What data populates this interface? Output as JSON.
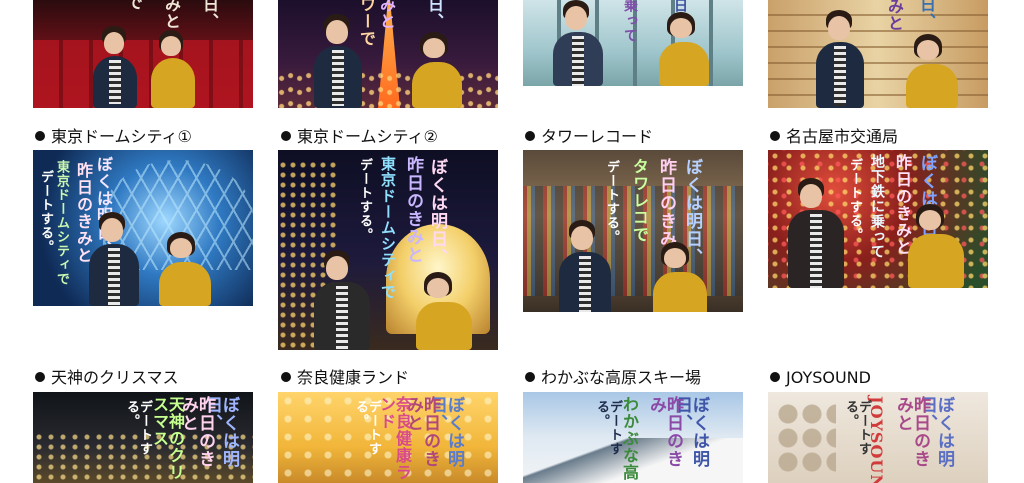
{
  "rows": {
    "row2": [
      {
        "caption": "東京ドームシティ①",
        "title_lines": [
          "ぼくは明日、",
          "昨日のきみと",
          "東京ドームシティで",
          "デートする。"
        ]
      },
      {
        "caption": "東京ドームシティ②",
        "title_lines": [
          "ぼくは明日、",
          "昨日のきみと",
          "東京ドームシティで",
          "デートする。"
        ]
      },
      {
        "caption": "タワーレコード",
        "title_lines": [
          "ぼくは明日、",
          "昨日のきみと",
          "タワレコで",
          "デートする。"
        ]
      },
      {
        "caption": "名古屋市交通局",
        "title_lines": [
          "ぼくは明日、",
          "昨日のきみと",
          "地下鉄に乗って",
          "デートする。"
        ]
      }
    ],
    "row3": [
      {
        "caption": "天神のクリスマス",
        "title_lines": [
          "ぼくは明日、",
          "昨日のきみと",
          "天神のクリスマス",
          "デートする。"
        ]
      },
      {
        "caption": "奈良健康ランド",
        "title_lines": [
          "ぼくは明日、",
          "昨日のきみと",
          "奈良健康ランド",
          "デートする。"
        ]
      },
      {
        "caption": "わかぶな高原スキー場",
        "title_lines": [
          "ぼくは明日、",
          "昨日のきみ",
          "わかぶな高",
          "デートする。"
        ]
      },
      {
        "caption": "JOYSOUND",
        "title_lines": [
          "ぼくは明日、",
          "昨日のきみと",
          "JOYSOUND",
          "デートする。"
        ]
      }
    ],
    "row1_titles": [
      {
        "title_lines": [
          "で",
          "みと",
          "日、"
        ]
      },
      {
        "title_lines": [
          "日、",
          "みと",
          "ワーで"
        ]
      },
      {
        "title_lines": [
          "日、",
          "乗って"
        ]
      },
      {
        "title_lines": [
          "日、",
          "みと"
        ]
      }
    ]
  },
  "colors": {
    "bullet": "#111111",
    "coat_male": "#1d2a3f",
    "sweater_female": "#d6a521"
  }
}
